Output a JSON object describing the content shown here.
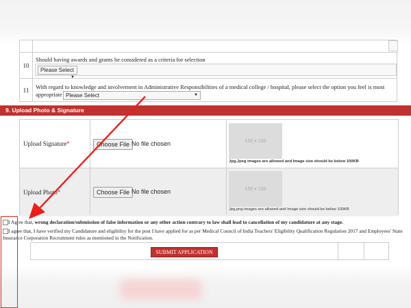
{
  "questions": [
    {
      "number": "10",
      "text": "Should having awards and grants be considered as a criteria for selection",
      "select_value": "Please Select"
    },
    {
      "number": "11",
      "text_line1": "With regard to knowledge and involvement in Administrative Responsibilities of a medical college / hospital, please select the option you feel is most",
      "text_line2": "appropriate",
      "select_value": "Please Select"
    }
  ],
  "section": {
    "title": "9. Upload Photo & Signature"
  },
  "uploads": [
    {
      "label": "Upload Signature",
      "required_mark": "*",
      "button": "Choose File",
      "status": "No file chosen",
      "placeholder": "150 x 100",
      "hint": "Jpg,Jpeg images are allowed and Image size should be below 100KB"
    },
    {
      "label": "Upload Photo",
      "required_mark": "*",
      "button": "Choose File",
      "status": "No file chosen",
      "placeholder": "150 x 100",
      "hint": "Jpg,png images are allowed and Image size should be below 100KB"
    }
  ],
  "agreements": [
    {
      "prefix": "I Agree that, ",
      "bold": "wrong declaration/submission of false information or any other action contrary to law shall lead to cancellation of my candidature at any stage."
    },
    {
      "line1": "I agree that, I have verified my Candidature and eligibility for the post I have applied for as per Medical Council of India Teachers' Eligibility Qualification Regulation 2017 and Employees' State",
      "line2": "Insurance Corporation Recruitment rules as mentioned in the Notification."
    }
  ],
  "submit": {
    "label": "SUBMIT APPLICATION"
  },
  "colors": {
    "accent": "#c0312f",
    "annotation": "#e8201c"
  }
}
